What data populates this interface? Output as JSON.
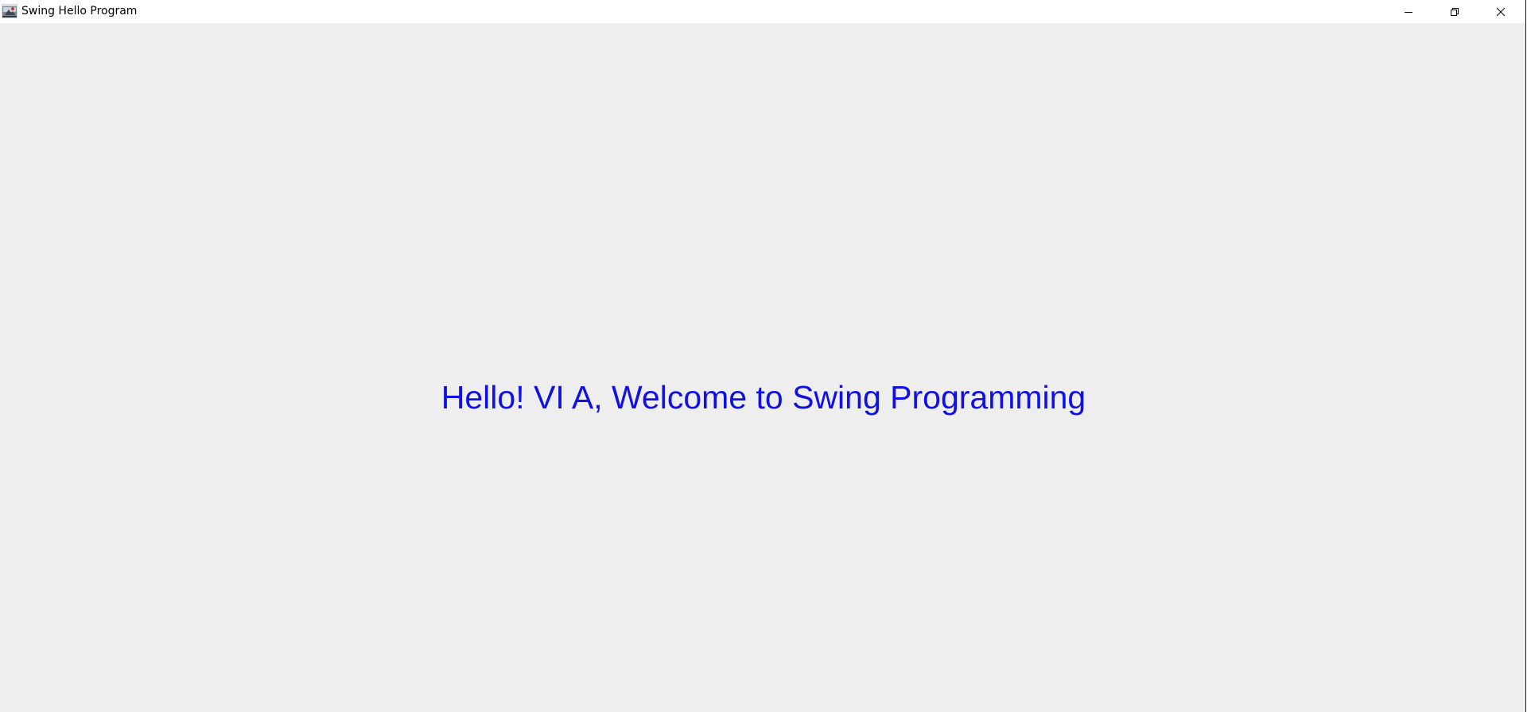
{
  "window": {
    "title": "Swing Hello Program",
    "app_icon": "java-cup-icon",
    "controls": {
      "minimize_icon": "minimize-icon",
      "restore_icon": "restore-icon",
      "close_icon": "close-icon"
    }
  },
  "content": {
    "label_text": "Hello! VI A, Welcome to Swing Programming",
    "label_color": "#1010e6",
    "background": "#eeeeee"
  }
}
